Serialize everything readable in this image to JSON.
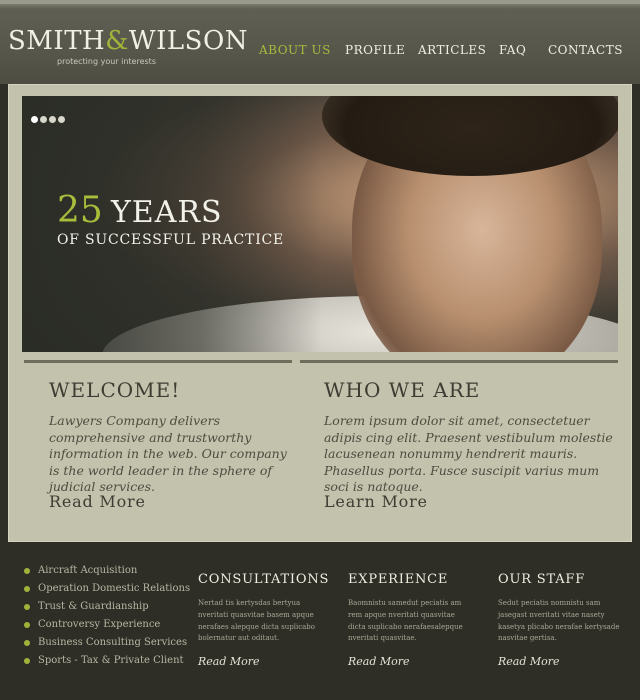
{
  "header": {
    "logo_left": "SMITH",
    "logo_amp": "&",
    "logo_right": "WILSON",
    "tagline": "protecting your interests",
    "nav": [
      "ABOUT US",
      "PROFILE",
      "ARTICLES",
      "FAQ",
      "CONTACTS"
    ],
    "active_nav": "ABOUT US"
  },
  "hero": {
    "slide_count": 4,
    "active_slide": 1,
    "number": "25",
    "word": "YEARS",
    "subtitle": "OF SUCCESSFUL PRACTICE"
  },
  "welcome": {
    "title": "WELCOME!",
    "text": "Lawyers Company delivers comprehensive and trustworthy information in the web. Our company is the world leader in the sphere of judicial services.",
    "link": "Read More"
  },
  "who_we_are": {
    "title": "WHO WE ARE",
    "text": "Lorem ipsum dolor sit amet, consectetuer adipis cing elit. Praesent vestibulum molestie lacusenean nonummy hendrerit mauris. Phasellus porta. Fusce suscipit varius mum soci is natoque.",
    "link": "Learn More"
  },
  "footer": {
    "services": [
      "Aircraft Acquisition",
      "Operation Domestic Relations",
      "Trust & Guardianship",
      "Controversy Experience",
      "Business Consulting Services",
      "Sports - Tax & Private Client"
    ],
    "columns": [
      {
        "title": "CONSULTATIONS",
        "text": "Nertad tis kertysdas bertyua nveritati quasvitae basem apque nerafaes alepque dicta suplicabo bolernatur aut oditaut.",
        "link": "Read More"
      },
      {
        "title": "EXPERIENCE",
        "text": "Baomnistu samedut peciatis am rem apque nveritati quasvitae dicta suplicabo nerafaesalepque nveritati quasvitae.",
        "link": "Read More"
      },
      {
        "title": "OUR STAFF",
        "text": "Sedut peciatis nomnistu sam jasegast nveritati vitae nasety kasetya plicabo nerafae kertysade nasvitae gertisa.",
        "link": "Read More"
      }
    ]
  },
  "colors": {
    "accent": "#a9ba3c",
    "header_bg": "#56564a",
    "panel_bg": "#c3c2ac",
    "footer_bg": "#2e2e27"
  }
}
